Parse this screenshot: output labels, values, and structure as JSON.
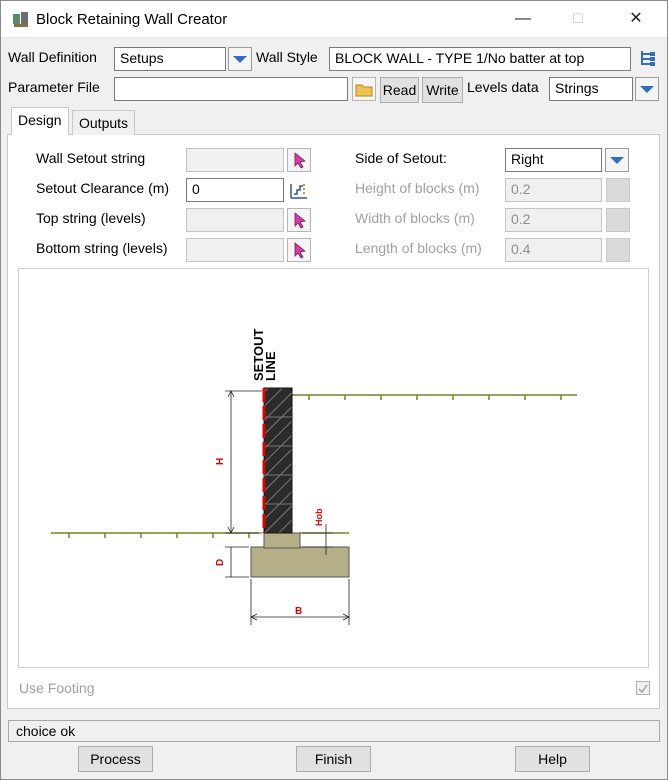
{
  "window": {
    "title": "Block Retaining Wall Creator",
    "minimize": "—",
    "maximize": "☐",
    "close": "✕"
  },
  "top": {
    "wall_definition_label": "Wall Definition",
    "wall_definition_value": "Setups",
    "wall_style_label": "Wall Style",
    "wall_style_value": "BLOCK WALL - TYPE 1/No batter at top",
    "parameter_file_label": "Parameter File",
    "parameter_file_value": "",
    "read_label": "Read",
    "write_label": "Write",
    "levels_data_label": "Levels data",
    "levels_data_value": "Strings"
  },
  "tabs": [
    {
      "label": "Design"
    },
    {
      "label": "Outputs"
    }
  ],
  "design": {
    "wall_setout_label": "Wall Setout string",
    "setout_clearance_label": "Setout Clearance (m)",
    "setout_clearance_value": "0",
    "top_string_label": "Top string (levels)",
    "bottom_string_label": "Bottom string (levels)",
    "side_of_setout_label": "Side of Setout:",
    "side_of_setout_value": "Right",
    "height_blocks_label": "Height of blocks (m)",
    "height_blocks_value": "0.2",
    "width_blocks_label": "Width of blocks (m)",
    "width_blocks_value": "0.2",
    "length_blocks_label": "Length of blocks (m)",
    "length_blocks_value": "0.4",
    "use_footing_label": "Use Footing",
    "use_footing_checked": true
  },
  "diagram": {
    "setout_label_1": "SETOUT",
    "setout_label_2": "LINE",
    "label_h": "H",
    "label_d": "D",
    "label_b": "B",
    "label_hob": "Hob",
    "colors": {
      "ground": "#6b8c1a",
      "dim": "#e00000",
      "footing": "#b5af88",
      "wall": "#2f2f2f"
    }
  },
  "status": {
    "message": "choice ok"
  },
  "buttons": {
    "process": "Process",
    "finish": "Finish",
    "help": "Help"
  }
}
